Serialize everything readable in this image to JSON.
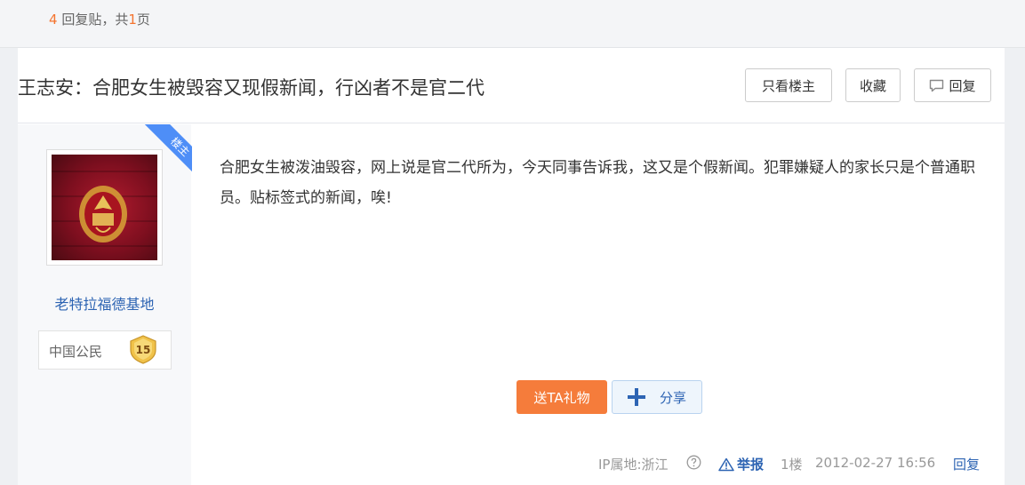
{
  "thread": {
    "reply_count": "4",
    "reply_label": "回复贴，共",
    "page_count": "1",
    "page_suffix": "页"
  },
  "post": {
    "title": "王志安：合肥女生被毁容又现假新闻，行凶者不是官二代",
    "buttons": {
      "only_op": "只看楼主",
      "favorite": "收藏",
      "reply": "回复"
    },
    "ribbon": "楼主",
    "content": "合肥女生被泼油毁容，网上说是官二代所为，今天同事告诉我，这又是个假新闻。犯罪嫌疑人的家长只是个普通职员。贴标签式的新闻，唉!",
    "actions": {
      "gift": "送TA礼物",
      "share": "分享"
    }
  },
  "author": {
    "username": "老特拉福德基地",
    "title": "中国公民",
    "level": "15"
  },
  "footer": {
    "ip": "IP属地:浙江",
    "report": "举报",
    "floor": "1楼",
    "time": "2012-02-27 16:56",
    "reply": "回复"
  },
  "colors": {
    "accent_orange": "#f57c3b",
    "link_blue": "#2d64b3",
    "ribbon_blue": "#4e8ef7"
  },
  "icons": [
    "comment-icon",
    "plus-icon",
    "help-icon",
    "warning-icon",
    "level-badge-icon"
  ]
}
